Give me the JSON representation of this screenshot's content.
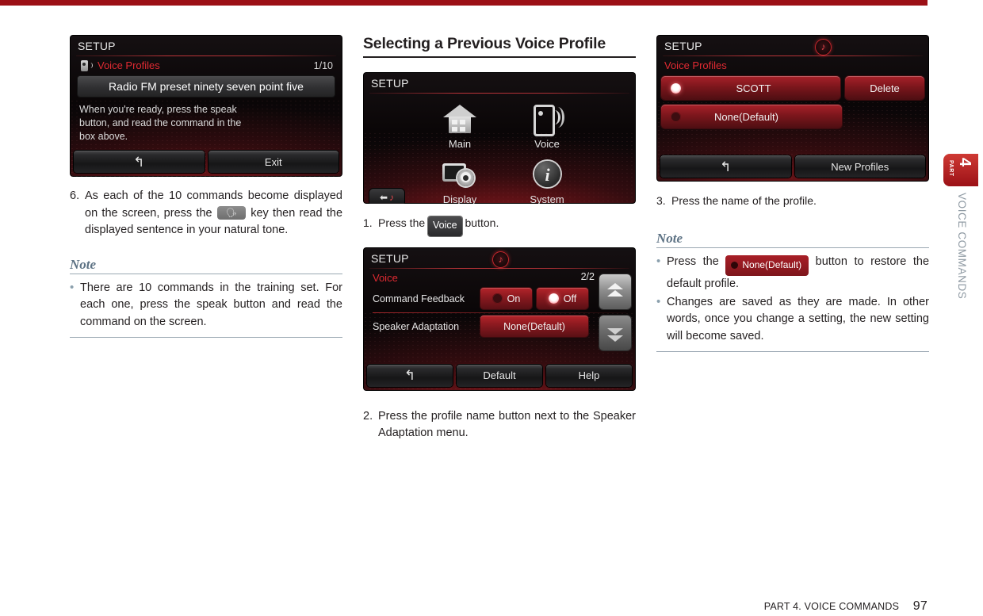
{
  "page": {
    "footer_text": "PART 4. VOICE COMMANDS",
    "page_number": "97",
    "side_tab_part_label": "PART",
    "side_tab_part_number": "4",
    "side_tab_section": "VOICE COMMANDS",
    "accent_color": "#9c1016",
    "note_color": "#5d7284"
  },
  "left": {
    "screen": {
      "title": "SETUP",
      "subtitle": "Voice Profiles",
      "pager": "1/10",
      "command_text": "Radio FM preset ninety seven point five",
      "hint_lines": [
        "When you're ready, press the speak",
        "button, and read the command in the",
        "box above."
      ],
      "back_button": "↰",
      "exit_button": "Exit",
      "voice_profile_icon": "voice-profile-icon"
    },
    "step6": {
      "number": "6.",
      "text_before": "As each of the 10 commands become displayed on the screen, press the",
      "key_glyph": "speak-key-icon",
      "text_after": "key then read the displayed sentence in your natural tone."
    },
    "note": {
      "heading": "Note",
      "bullets": [
        "There are 10 commands in the training set. For each one, press the speak button and read the command on the screen."
      ],
      "bullet_glyph": "•"
    }
  },
  "middle": {
    "heading": "Selecting a Previous Voice Profile",
    "menu_screen": {
      "title": "SETUP",
      "items": [
        {
          "label": "Main",
          "icon": "home-icon"
        },
        {
          "label": "Voice",
          "icon": "voice-icon"
        },
        {
          "label": "Display",
          "icon": "display-gear-icon"
        },
        {
          "label": "System",
          "icon": "info-icon"
        }
      ],
      "back_button": "back-music-icon"
    },
    "step1": {
      "number": "1.",
      "text_before": "Press the",
      "button_label": "Voice",
      "text_after": "button."
    },
    "voice_screen": {
      "title": "SETUP",
      "cd_icon": "music-note-icon",
      "subtitle": "Voice",
      "pager": "2/2",
      "rows": [
        {
          "label": "Command Feedback",
          "options": [
            {
              "label": "On",
              "selected": false
            },
            {
              "label": "Off",
              "selected": true
            }
          ]
        },
        {
          "label": "Speaker Adaptation",
          "options": [
            {
              "label": "None(Default)",
              "selected": false
            }
          ]
        }
      ],
      "scroll_up": "chevron-up-icon",
      "scroll_down": "chevron-down-icon",
      "back_button": "↰",
      "default_button": "Default",
      "help_button": "Help"
    },
    "step2": {
      "number": "2.",
      "text": "Press the profile name button next to the Speaker Adaptation menu."
    }
  },
  "right": {
    "profiles_screen": {
      "title": "SETUP",
      "cd_icon": "music-note-icon",
      "subtitle": "Voice Profiles",
      "profiles": [
        {
          "name": "SCOTT",
          "selected": true
        },
        {
          "name": "None(Default)",
          "selected": false
        }
      ],
      "delete_button": "Delete",
      "back_button": "↰",
      "new_profiles_button": "New Profiles"
    },
    "step3": {
      "number": "3.",
      "text": "Press the name of the profile."
    },
    "note": {
      "heading": "Note",
      "bullet1_before": "Press the",
      "bullet1_button": "None(Default)",
      "bullet1_after": "button to restore the default profile.",
      "bullet2": "Changes are saved as they are made. In other words, once you change a setting, the new setting will become saved.",
      "bullet_glyph": "•"
    }
  }
}
